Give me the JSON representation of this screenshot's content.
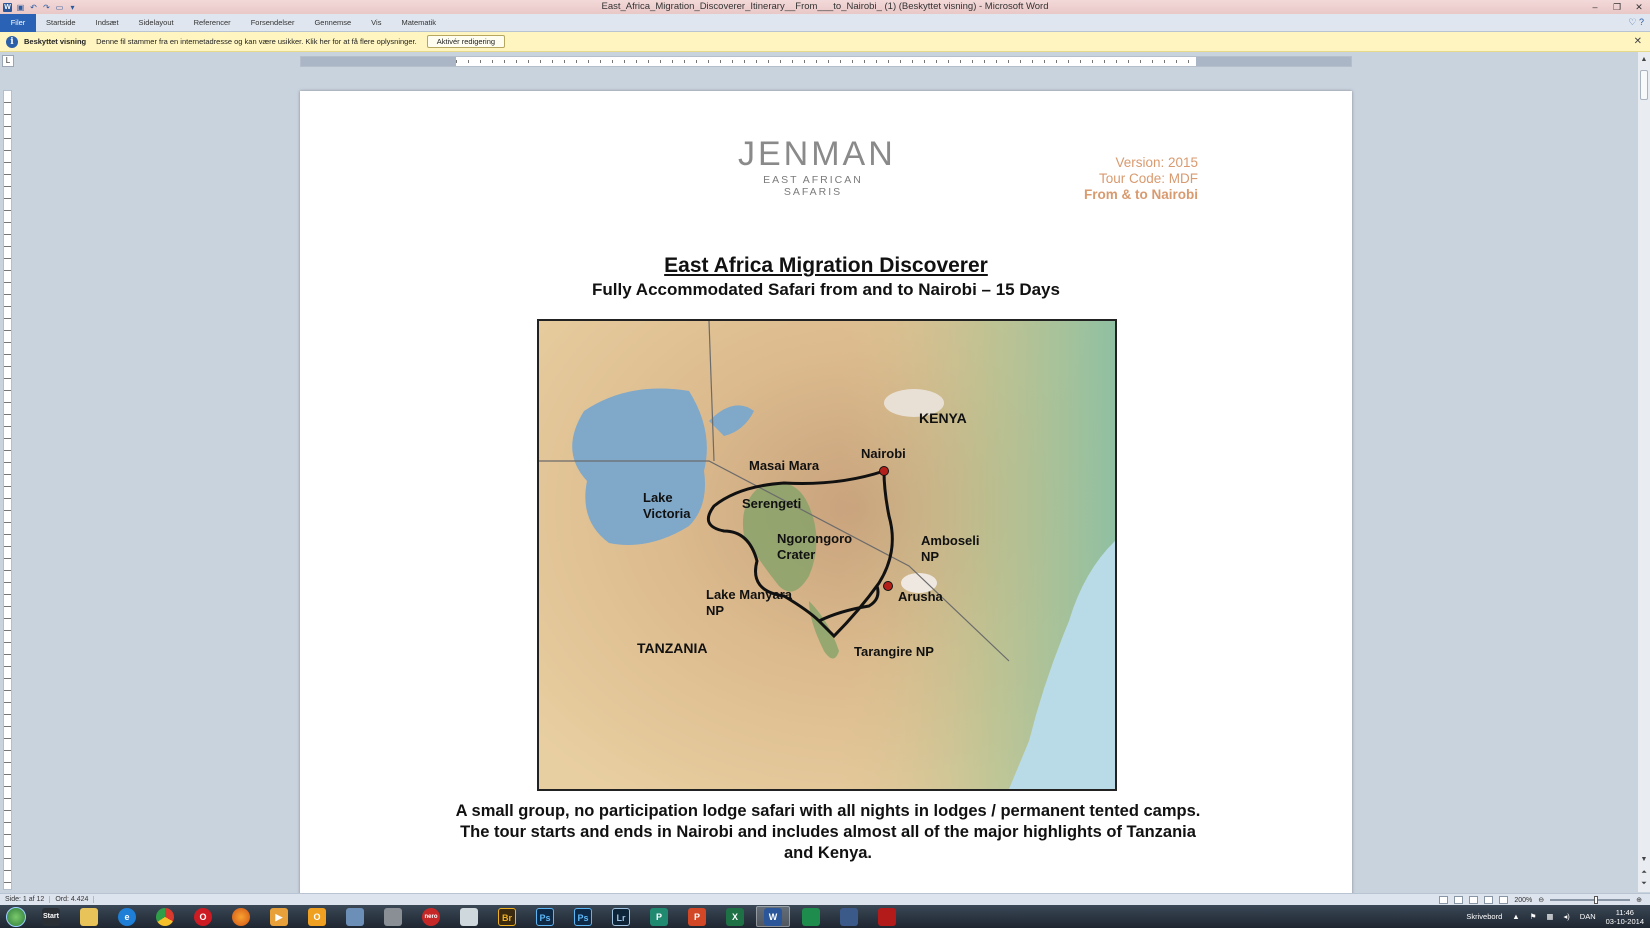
{
  "window": {
    "title": "East_Africa_Migration_Discoverer_Itinerary__From___to_Nairobi_ (1) (Beskyttet visning) - Microsoft Word",
    "controls": [
      "–",
      "❐",
      "✕"
    ]
  },
  "ribbon": {
    "file_tab": "Filer",
    "tabs": [
      "Startside",
      "Indsæt",
      "Sidelayout",
      "Referencer",
      "Forsendelser",
      "Gennemse",
      "Vis",
      "Matematik"
    ]
  },
  "protected_view": {
    "title": "Beskyttet visning",
    "message": "Denne fil stammer fra en internetadresse og kan være usikker. Klik her for at få flere oplysninger.",
    "button": "Aktivér redigering"
  },
  "document": {
    "logo_main": "JENMAN",
    "logo_sub": "EAST AFRICAN SAFARIS",
    "version": "Version: 2015",
    "tour_code": "Tour Code: MDF",
    "route": "From & to Nairobi",
    "title": "East Africa Migration Discoverer",
    "subtitle": "Fully Accommodated Safari from and to Nairobi – 15 Days",
    "intro": "A small group, no participation lodge safari with all nights in lodges / permanent tented camps. The tour starts and ends in Nairobi and includes almost all of the major highlights of Tanzania and Kenya."
  },
  "map": {
    "labels": {
      "kenya": "KENYA",
      "tanzania": "TANZANIA",
      "nairobi": "Nairobi",
      "masai_mara": "Masai Mara",
      "lake_victoria_1": "Lake",
      "lake_victoria_2": "Victoria",
      "serengeti": "Serengeti",
      "ngorongoro_1": "Ngorongoro",
      "ngorongoro_2": "Crater",
      "amboseli_1": "Amboseli",
      "amboseli_2": "NP",
      "arusha": "Arusha",
      "manyara_1": "Lake Manyara",
      "manyara_2": "NP",
      "tarangire": "Tarangire NP"
    }
  },
  "status": {
    "page": "Side: 1 af 12",
    "words": "Ord: 4.424",
    "zoom": "200%"
  },
  "taskbar": {
    "apps": [
      {
        "name": "start-menu",
        "label": "Start"
      },
      {
        "name": "explorer",
        "label": ""
      },
      {
        "name": "ie",
        "label": "e"
      },
      {
        "name": "chrome",
        "label": ""
      },
      {
        "name": "opera",
        "label": "O"
      },
      {
        "name": "firefox",
        "label": ""
      },
      {
        "name": "media",
        "label": "▶"
      },
      {
        "name": "outlook",
        "label": "O"
      },
      {
        "name": "app9",
        "label": ""
      },
      {
        "name": "app10",
        "label": ""
      },
      {
        "name": "nero",
        "label": "nero"
      },
      {
        "name": "app12",
        "label": ""
      },
      {
        "name": "bridge",
        "label": "Br"
      },
      {
        "name": "photoshop1",
        "label": "Ps"
      },
      {
        "name": "photoshop2",
        "label": "Ps"
      },
      {
        "name": "lightroom",
        "label": "Lr"
      },
      {
        "name": "publisher",
        "label": "P"
      },
      {
        "name": "powerpoint",
        "label": "P"
      },
      {
        "name": "excel",
        "label": "X"
      },
      {
        "name": "word",
        "label": "W"
      },
      {
        "name": "app21",
        "label": ""
      },
      {
        "name": "app22",
        "label": ""
      },
      {
        "name": "acrobat",
        "label": ""
      }
    ],
    "tray_text": "Skrivebord",
    "language": "DAN",
    "time": "11:46",
    "date": "03-10-2014"
  },
  "colors": {
    "accent_orange": "#d89a6f",
    "word_blue": "#2b579a",
    "route_red": "#b3201a"
  }
}
